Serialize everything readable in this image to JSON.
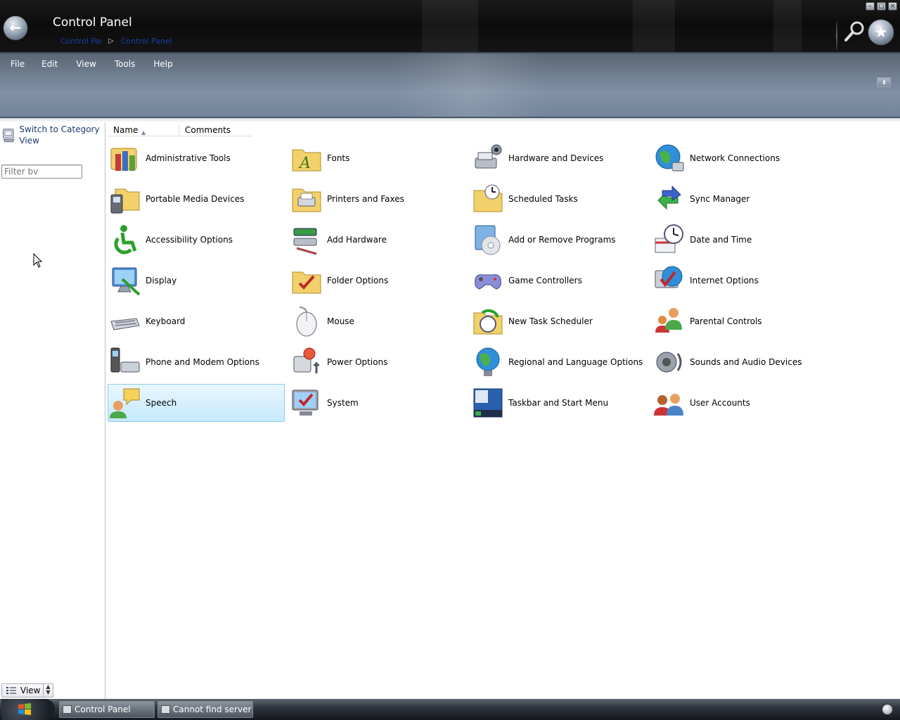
{
  "window": {
    "title": "Control Panel",
    "breadcrumbs": [
      "Control Panel",
      "Control Panel"
    ],
    "buttons": [
      "minimize",
      "maximize",
      "close"
    ]
  },
  "menu": [
    "File",
    "Edit",
    "View",
    "Tools",
    "Help"
  ],
  "left_pane": {
    "switch_view": "Switch to Category View",
    "filter_placeholder": "Filter bv",
    "view_button": "View"
  },
  "columns": {
    "name": "Name",
    "comments": "Comments"
  },
  "items": [
    {
      "label": "Administrative Tools",
      "icon": "admin-tools-icon"
    },
    {
      "label": "Fonts",
      "icon": "fonts-folder-icon"
    },
    {
      "label": "Hardware and Devices",
      "icon": "hardware-icon"
    },
    {
      "label": "Network Connections",
      "icon": "network-globe-icon"
    },
    {
      "label": "Portable Media Devices",
      "icon": "portable-media-icon"
    },
    {
      "label": "Printers and Faxes",
      "icon": "printer-folder-icon"
    },
    {
      "label": "Scheduled Tasks",
      "icon": "scheduled-folder-icon"
    },
    {
      "label": "Sync Manager",
      "icon": "sync-icon"
    },
    {
      "label": "Accessibility Options",
      "icon": "accessibility-icon"
    },
    {
      "label": "Add Hardware",
      "icon": "add-hardware-icon"
    },
    {
      "label": "Add or Remove Programs",
      "icon": "add-remove-programs-icon"
    },
    {
      "label": "Date and Time",
      "icon": "date-time-icon"
    },
    {
      "label": "Display",
      "icon": "display-icon"
    },
    {
      "label": "Folder Options",
      "icon": "folder-options-icon"
    },
    {
      "label": "Game Controllers",
      "icon": "gamepad-icon"
    },
    {
      "label": "Internet Options",
      "icon": "internet-options-icon"
    },
    {
      "label": "Keyboard",
      "icon": "keyboard-icon"
    },
    {
      "label": "Mouse",
      "icon": "mouse-icon"
    },
    {
      "label": "New Task Scheduler",
      "icon": "task-scheduler-icon"
    },
    {
      "label": "Parental Controls",
      "icon": "parental-controls-icon"
    },
    {
      "label": "Phone and Modem Options",
      "icon": "phone-modem-icon"
    },
    {
      "label": "Power Options",
      "icon": "power-icon"
    },
    {
      "label": "Regional and Language Options",
      "icon": "regional-globe-icon"
    },
    {
      "label": "Sounds and Audio Devices",
      "icon": "speaker-icon"
    },
    {
      "label": "Speech",
      "icon": "speech-icon",
      "selected": true
    },
    {
      "label": "System",
      "icon": "system-icon"
    },
    {
      "label": "Taskbar and Start Menu",
      "icon": "taskbar-icon"
    },
    {
      "label": "User Accounts",
      "icon": "user-accounts-icon"
    }
  ],
  "taskbar": {
    "tasks": [
      "Control Panel",
      "Cannot find server"
    ]
  },
  "colors": {
    "title_bar": "#0c0c0c",
    "menu_bar": "#7a8ba0",
    "selection": "#c6e9fd",
    "link_text": "#1a3a6e"
  }
}
